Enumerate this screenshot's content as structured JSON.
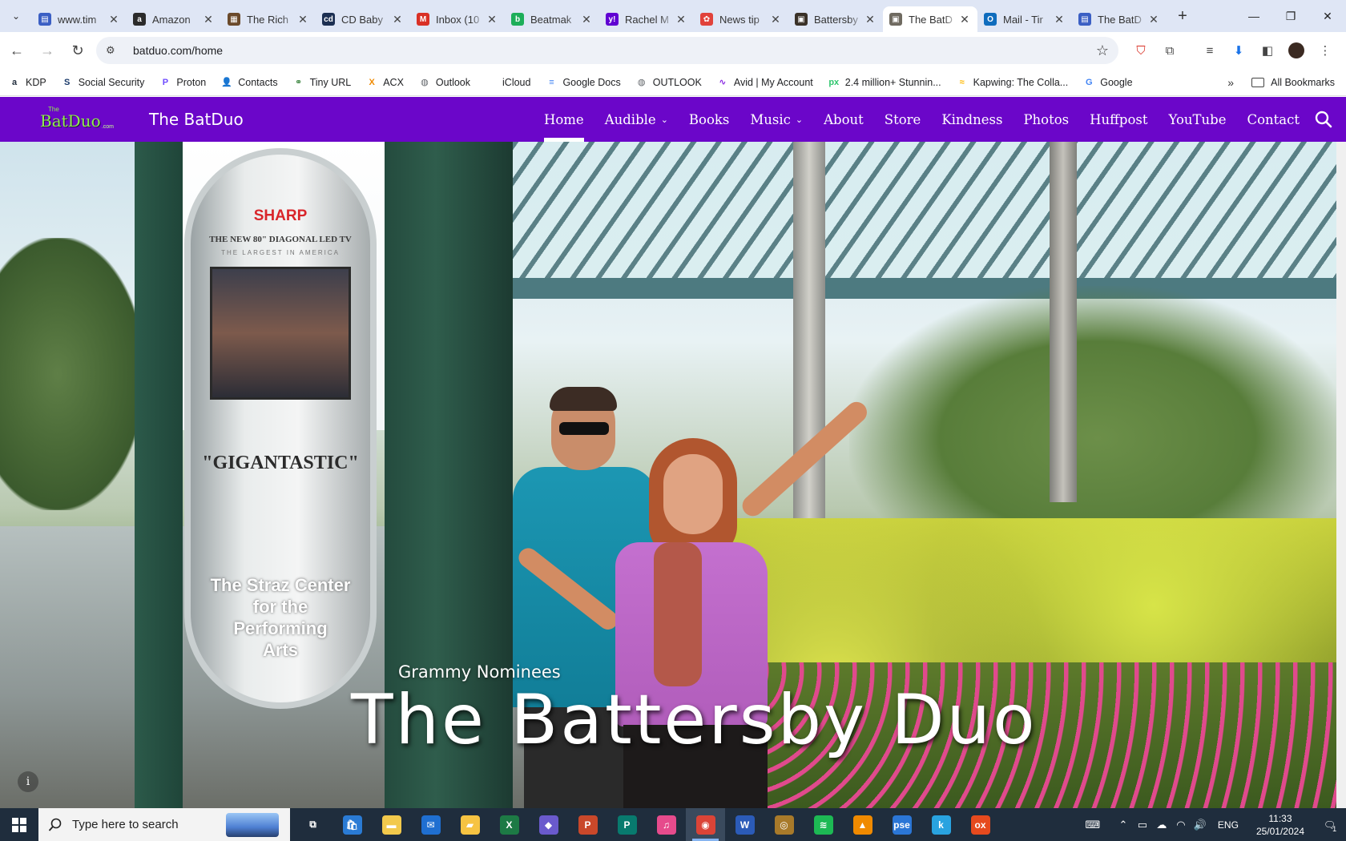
{
  "browser": {
    "tabs": [
      {
        "title": "www.tim",
        "fav_color": "#3b5fc4",
        "fav_glyph": "▤"
      },
      {
        "title": "Amazon",
        "fav_color": "#2b2b2b",
        "fav_glyph": "a"
      },
      {
        "title": "The Rich",
        "fav_color": "#6b4a2b",
        "fav_glyph": "▦"
      },
      {
        "title": "CD Baby",
        "fav_color": "#1c2f52",
        "fav_glyph": "cd"
      },
      {
        "title": "Inbox (10",
        "fav_color": "#d93025",
        "fav_glyph": "M"
      },
      {
        "title": "Beatmak",
        "fav_color": "#1dae59",
        "fav_glyph": "b"
      },
      {
        "title": "Rachel M",
        "fav_color": "#6001d2",
        "fav_glyph": "y!"
      },
      {
        "title": "News tip",
        "fav_color": "#e1423b",
        "fav_glyph": "✿"
      },
      {
        "title": "Battersby",
        "fav_color": "#3a3128",
        "fav_glyph": "▣"
      },
      {
        "title": "The BatD",
        "fav_color": "#6f6a60",
        "fav_glyph": "▣"
      },
      {
        "title": "Mail - Tir",
        "fav_color": "#0f6cbd",
        "fav_glyph": "O"
      },
      {
        "title": "The BatD",
        "fav_color": "#3b5fc4",
        "fav_glyph": "▤"
      }
    ],
    "active_tab_index": 9,
    "url": "batduo.com/home",
    "bookmarks": [
      {
        "label": "KDP",
        "icon": "kdp-icon",
        "color": "#232f3e",
        "glyph": "a"
      },
      {
        "label": "Social Security",
        "icon": "ssa-icon",
        "color": "#1a3a6b",
        "glyph": "S"
      },
      {
        "label": "Proton",
        "icon": "proton-icon",
        "color": "#6d4aff",
        "glyph": "P"
      },
      {
        "label": "Contacts",
        "icon": "contacts-icon",
        "color": "#1a73e8",
        "glyph": "👤"
      },
      {
        "label": "Tiny URL",
        "icon": "tinyurl-icon",
        "color": "#2e7d32",
        "glyph": "⚭"
      },
      {
        "label": "ACX",
        "icon": "acx-icon",
        "color": "#f08a00",
        "glyph": "X"
      },
      {
        "label": "Outlook",
        "icon": "globe-icon",
        "color": "#5f6368",
        "glyph": "◍"
      },
      {
        "label": "iCloud",
        "icon": "apple-icon",
        "color": "#5f6368",
        "glyph": ""
      },
      {
        "label": "Google Docs",
        "icon": "docs-icon",
        "color": "#4285f4",
        "glyph": "≡"
      },
      {
        "label": "OUTLOOK",
        "icon": "globe-icon",
        "color": "#5f6368",
        "glyph": "◍"
      },
      {
        "label": "Avid | My Account",
        "icon": "avid-icon",
        "color": "#8a2be2",
        "glyph": "∿"
      },
      {
        "label": "2.4 million+ Stunnin...",
        "icon": "pixabay-icon",
        "color": "#2ec66d",
        "glyph": "px"
      },
      {
        "label": "Kapwing: The Colla...",
        "icon": "kapwing-icon",
        "color": "#ffb800",
        "glyph": "≈"
      },
      {
        "label": "Google",
        "icon": "google-icon",
        "color": "#4285f4",
        "glyph": "G"
      }
    ],
    "all_bookmarks": "All Bookmarks"
  },
  "site": {
    "logo_small": "The",
    "logo_big": "BatDuo",
    "logo_dot": ".com",
    "name": "The BatDuo",
    "menu": [
      {
        "label": "Home",
        "active": true,
        "dropdown": false
      },
      {
        "label": "Audible",
        "active": false,
        "dropdown": true
      },
      {
        "label": "Books",
        "active": false,
        "dropdown": false
      },
      {
        "label": "Music",
        "active": false,
        "dropdown": true
      },
      {
        "label": "About",
        "active": false,
        "dropdown": false
      },
      {
        "label": "Store",
        "active": false,
        "dropdown": false
      },
      {
        "label": "Kindness",
        "active": false,
        "dropdown": false
      },
      {
        "label": "Photos",
        "active": false,
        "dropdown": false
      },
      {
        "label": "Huffpost",
        "active": false,
        "dropdown": false
      },
      {
        "label": "YouTube",
        "active": false,
        "dropdown": false
      },
      {
        "label": "Contact",
        "active": false,
        "dropdown": false
      }
    ],
    "nav_color": "#6b06c9",
    "hero": {
      "kiosk_brand": "SHARP",
      "kiosk_tag": "THE NEW 80\" DIAGONAL LED TV",
      "kiosk_tag2": "THE LARGEST IN AMERICA",
      "kiosk_quote": "\"GIGANTASTIC\"",
      "kiosk_caption": "The Straz Center\nfor the\nPerforming\nArts",
      "subtitle": "Grammy Nominees",
      "title": "The Battersby Duo",
      "info_glyph": "i"
    }
  },
  "taskbar": {
    "search_placeholder": "Type here to search",
    "apps": [
      {
        "name": "task-view",
        "glyph": "⧉",
        "color": "transparent",
        "open": false
      },
      {
        "name": "store",
        "glyph": "🛍",
        "color": "#2a7bd5",
        "open": false
      },
      {
        "name": "file-explorer",
        "glyph": "▬",
        "color": "#f2c94c",
        "open": false
      },
      {
        "name": "mail",
        "glyph": "✉",
        "color": "#1f6fd1",
        "open": false
      },
      {
        "name": "files",
        "glyph": "▰",
        "color": "#f6c342",
        "open": false
      },
      {
        "name": "excel",
        "glyph": "X",
        "color": "#1d7a45",
        "open": false
      },
      {
        "name": "clipchamp",
        "glyph": "◆",
        "color": "#6a5acd",
        "open": false
      },
      {
        "name": "powerpoint",
        "glyph": "P",
        "color": "#c9482a",
        "open": false
      },
      {
        "name": "publisher",
        "glyph": "P",
        "color": "#087a6e",
        "open": false
      },
      {
        "name": "itunes",
        "glyph": "♫",
        "color": "#e64b8c",
        "open": false
      },
      {
        "name": "chrome",
        "glyph": "◉",
        "color": "#db4437",
        "open": true
      },
      {
        "name": "word",
        "glyph": "W",
        "color": "#2b5bb8",
        "open": false
      },
      {
        "name": "compass",
        "glyph": "◎",
        "color": "#a87a2a",
        "open": false
      },
      {
        "name": "spotify",
        "glyph": "≋",
        "color": "#1db954",
        "open": false
      },
      {
        "name": "vlc",
        "glyph": "▲",
        "color": "#f08a00",
        "open": false
      },
      {
        "name": "photoshop-elements",
        "glyph": "pse",
        "color": "#2b76d6",
        "open": false
      },
      {
        "name": "k-app",
        "glyph": "k",
        "color": "#29a3e0",
        "open": false
      },
      {
        "name": "ox-app",
        "glyph": "ox",
        "color": "#e64a1e",
        "open": false
      }
    ],
    "lang": "ENG",
    "time": "11:33",
    "date": "25/01/2024",
    "notif_count": "1"
  }
}
